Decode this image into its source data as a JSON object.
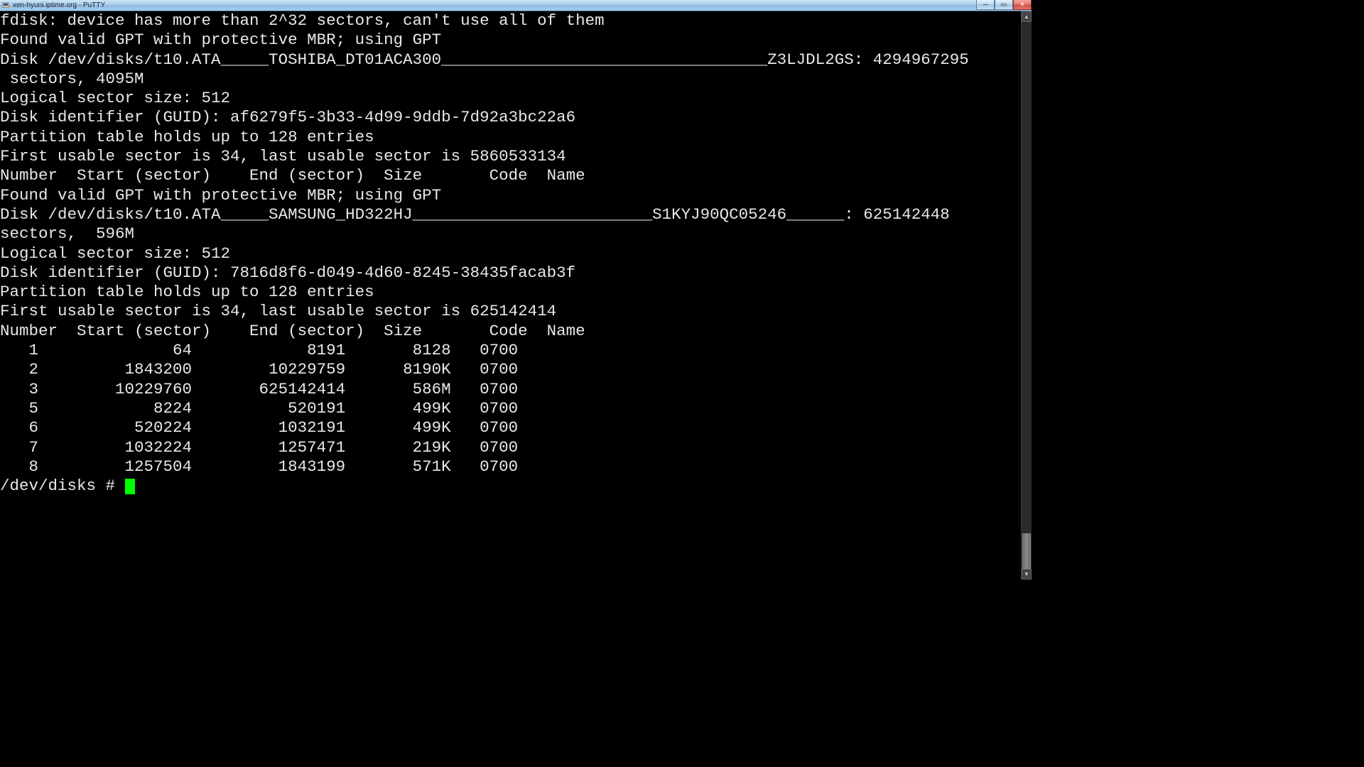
{
  "window": {
    "title": "xen-hyuni.iptime.org - PuTTY"
  },
  "terminal": {
    "lines": [
      "fdisk: device has more than 2^32 sectors, can't use all of them",
      "Found valid GPT with protective MBR; using GPT",
      "",
      "Disk /dev/disks/t10.ATA_____TOSHIBA_DT01ACA300__________________________________Z3LJDL2GS: 4294967295",
      " sectors, 4095M",
      "Logical sector size: 512",
      "Disk identifier (GUID): af6279f5-3b33-4d99-9ddb-7d92a3bc22a6",
      "Partition table holds up to 128 entries",
      "First usable sector is 34, last usable sector is 5860533134",
      "",
      "Number  Start (sector)    End (sector)  Size       Code  Name",
      "Found valid GPT with protective MBR; using GPT",
      "",
      "Disk /dev/disks/t10.ATA_____SAMSUNG_HD322HJ_________________________S1KYJ90QC05246______: 625142448 ",
      "sectors,  596M",
      "Logical sector size: 512",
      "Disk identifier (GUID): 7816d8f6-d049-4d60-8245-38435facab3f",
      "Partition table holds up to 128 entries",
      "First usable sector is 34, last usable sector is 625142414",
      "",
      "Number  Start (sector)    End (sector)  Size       Code  Name",
      "   1              64            8191       8128   0700",
      "   2         1843200        10229759      8190K   0700",
      "   3        10229760       625142414       586M   0700",
      "   5            8224          520191       499K   0700",
      "   6          520224         1032191       499K   0700",
      "   7         1032224         1257471       219K   0700",
      "   8         1257504         1843199       571K   0700"
    ],
    "prompt": "/dev/disks # "
  },
  "chart_data": {
    "type": "table",
    "title": "Partition table (fdisk output)",
    "columns": [
      "Number",
      "Start (sector)",
      "End (sector)",
      "Size",
      "Code",
      "Name"
    ],
    "rows": [
      {
        "Number": 1,
        "Start (sector)": 64,
        "End (sector)": 8191,
        "Size": "8128",
        "Code": "0700",
        "Name": ""
      },
      {
        "Number": 2,
        "Start (sector)": 1843200,
        "End (sector)": 10229759,
        "Size": "8190K",
        "Code": "0700",
        "Name": ""
      },
      {
        "Number": 3,
        "Start (sector)": 10229760,
        "End (sector)": 625142414,
        "Size": "586M",
        "Code": "0700",
        "Name": ""
      },
      {
        "Number": 5,
        "Start (sector)": 8224,
        "End (sector)": 520191,
        "Size": "499K",
        "Code": "0700",
        "Name": ""
      },
      {
        "Number": 6,
        "Start (sector)": 520224,
        "End (sector)": 1032191,
        "Size": "499K",
        "Code": "0700",
        "Name": ""
      },
      {
        "Number": 7,
        "Start (sector)": 1032224,
        "End (sector)": 1257471,
        "Size": "219K",
        "Code": "0700",
        "Name": ""
      },
      {
        "Number": 8,
        "Start (sector)": 1257504,
        "End (sector)": 1843199,
        "Size": "571K",
        "Code": "0700",
        "Name": ""
      }
    ],
    "disks": [
      {
        "device": "/dev/disks/t10.ATA_____TOSHIBA_DT01ACA300__________________________________Z3LJDL2GS",
        "sectors": 4294967295,
        "size": "4095M",
        "logical_sector_size": 512,
        "guid": "af6279f5-3b33-4d99-9ddb-7d92a3bc22a6",
        "max_entries": 128,
        "first_usable_sector": 34,
        "last_usable_sector": 5860533134
      },
      {
        "device": "/dev/disks/t10.ATA_____SAMSUNG_HD322HJ_________________________S1KYJ90QC05246______",
        "sectors": 625142448,
        "size": "596M",
        "logical_sector_size": 512,
        "guid": "7816d8f6-d049-4d60-8245-38435facab3f",
        "max_entries": 128,
        "first_usable_sector": 34,
        "last_usable_sector": 625142414
      }
    ]
  }
}
